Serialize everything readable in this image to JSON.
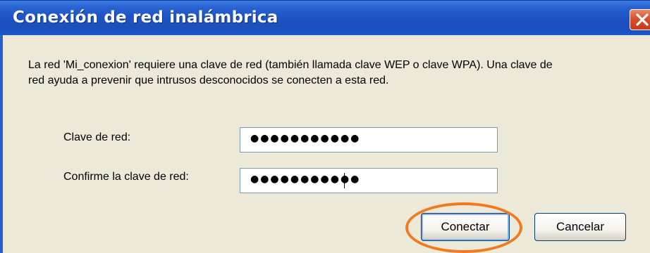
{
  "dialog": {
    "title": "Conexión de red inalámbrica",
    "message_line1": "La red 'Mi_conexion' requiere una clave de red (también llamada clave WEP o clave WPA). Una clave de",
    "message_line2": "red ayuda a prevenir que intrusos desconocidos se conecten a esta red."
  },
  "form": {
    "network_key_label": "Clave de red:",
    "network_key_value": "●●●●●●●●●●●",
    "confirm_key_label": "Confirme la clave de red:",
    "confirm_key_value": "●●●●●●●●●●●"
  },
  "buttons": {
    "connect_label": "Conectar",
    "cancel_label": "Cancelar"
  },
  "icons": {
    "close": "close-icon"
  },
  "colors": {
    "titlebar": "#1f55c4",
    "client_bg": "#ece9d8",
    "close_button": "#d9502d",
    "highlight_ring": "#f07b1f"
  }
}
